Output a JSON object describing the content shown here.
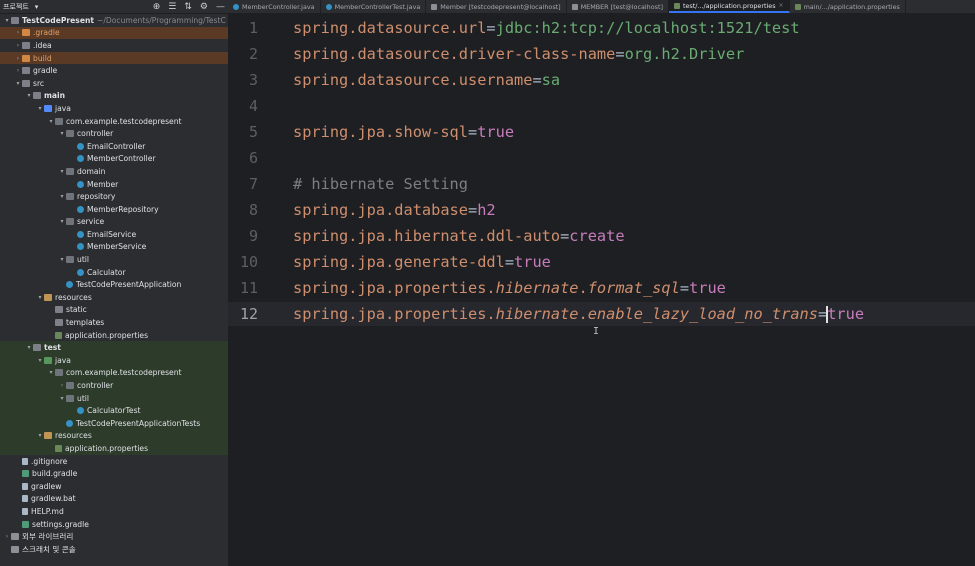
{
  "sidebar": {
    "title": "프로젝트",
    "title_arrow": "▾",
    "tools": [
      "⊕",
      "☰",
      "⇅",
      "⚙",
      "—"
    ],
    "rows": [
      {
        "indent": 0,
        "arrow": "▾",
        "icon": "folder",
        "label": "TestCodePresent",
        "extra": "~/Documents/Programming/TestC",
        "bold": true
      },
      {
        "indent": 1,
        "arrow": "›",
        "icon": "folder-orange",
        "label": ".gradle",
        "bg": "orange",
        "color": "orange"
      },
      {
        "indent": 1,
        "arrow": "›",
        "icon": "folder",
        "label": ".idea"
      },
      {
        "indent": 1,
        "arrow": "›",
        "icon": "folder-orange",
        "label": "build",
        "bg": "orange",
        "color": "orange"
      },
      {
        "indent": 1,
        "arrow": "›",
        "icon": "folder",
        "label": "gradle"
      },
      {
        "indent": 1,
        "arrow": "▾",
        "icon": "folder",
        "label": "src"
      },
      {
        "indent": 2,
        "arrow": "▾",
        "icon": "folder",
        "label": "main",
        "bold": true
      },
      {
        "indent": 3,
        "arrow": "▾",
        "icon": "folder-src",
        "label": "java"
      },
      {
        "indent": 4,
        "arrow": "▾",
        "icon": "pkg",
        "label": "com.example.testcodepresent"
      },
      {
        "indent": 5,
        "arrow": "▾",
        "icon": "pkg",
        "label": "controller"
      },
      {
        "indent": 6,
        "arrow": "",
        "icon": "cls",
        "label": "EmailController"
      },
      {
        "indent": 6,
        "arrow": "",
        "icon": "cls",
        "label": "MemberController"
      },
      {
        "indent": 5,
        "arrow": "▾",
        "icon": "pkg",
        "label": "domain"
      },
      {
        "indent": 6,
        "arrow": "",
        "icon": "cls",
        "label": "Member"
      },
      {
        "indent": 5,
        "arrow": "▾",
        "icon": "pkg",
        "label": "repository"
      },
      {
        "indent": 6,
        "arrow": "",
        "icon": "cls",
        "label": "MemberRepository"
      },
      {
        "indent": 5,
        "arrow": "▾",
        "icon": "pkg",
        "label": "service"
      },
      {
        "indent": 6,
        "arrow": "",
        "icon": "cls",
        "label": "EmailService"
      },
      {
        "indent": 6,
        "arrow": "",
        "icon": "cls",
        "label": "MemberService"
      },
      {
        "indent": 5,
        "arrow": "▾",
        "icon": "pkg",
        "label": "util"
      },
      {
        "indent": 6,
        "arrow": "",
        "icon": "cls",
        "label": "Calculator"
      },
      {
        "indent": 5,
        "arrow": "",
        "icon": "cls",
        "label": "TestCodePresentApplication"
      },
      {
        "indent": 3,
        "arrow": "▾",
        "icon": "folder-res",
        "label": "resources"
      },
      {
        "indent": 4,
        "arrow": "",
        "icon": "folder",
        "label": "static"
      },
      {
        "indent": 4,
        "arrow": "",
        "icon": "folder",
        "label": "templates"
      },
      {
        "indent": 4,
        "arrow": "",
        "icon": "prop",
        "label": "application.properties"
      },
      {
        "indent": 2,
        "arrow": "▾",
        "icon": "folder",
        "label": "test",
        "bold": true,
        "bg": "green"
      },
      {
        "indent": 3,
        "arrow": "▾",
        "icon": "folder-test",
        "label": "java",
        "bg": "green"
      },
      {
        "indent": 4,
        "arrow": "▾",
        "icon": "pkg",
        "label": "com.example.testcodepresent",
        "bg": "green"
      },
      {
        "indent": 5,
        "arrow": "›",
        "icon": "pkg",
        "label": "controller",
        "bg": "green"
      },
      {
        "indent": 5,
        "arrow": "▾",
        "icon": "pkg",
        "label": "util",
        "bg": "green"
      },
      {
        "indent": 6,
        "arrow": "",
        "icon": "cls",
        "label": "CalculatorTest",
        "bg": "green"
      },
      {
        "indent": 5,
        "arrow": "",
        "icon": "cls",
        "label": "TestCodePresentApplicationTests",
        "bg": "green"
      },
      {
        "indent": 3,
        "arrow": "▾",
        "icon": "folder-res",
        "label": "resources",
        "bg": "green"
      },
      {
        "indent": 4,
        "arrow": "",
        "icon": "prop",
        "label": "application.properties",
        "bg": "green"
      },
      {
        "indent": 1,
        "arrow": "",
        "icon": "file",
        "label": ".gitignore"
      },
      {
        "indent": 1,
        "arrow": "",
        "icon": "gradle",
        "label": "build.gradle"
      },
      {
        "indent": 1,
        "arrow": "",
        "icon": "file",
        "label": "gradlew"
      },
      {
        "indent": 1,
        "arrow": "",
        "icon": "file",
        "label": "gradlew.bat"
      },
      {
        "indent": 1,
        "arrow": "",
        "icon": "file",
        "label": "HELP.md"
      },
      {
        "indent": 1,
        "arrow": "",
        "icon": "gradle",
        "label": "settings.gradle"
      },
      {
        "indent": 0,
        "arrow": "›",
        "icon": "lib",
        "label": "외부 라이브러리"
      },
      {
        "indent": 0,
        "arrow": "",
        "icon": "lib",
        "label": "스크래치 및 콘솔"
      }
    ]
  },
  "tabs": [
    {
      "label": "MemberController.java",
      "icon": "class"
    },
    {
      "label": "MemberControllerTest.java",
      "icon": "class"
    },
    {
      "label": "Member [testcodepresent@localhost]",
      "icon": "db"
    },
    {
      "label": "MEMBER [test@localhost]",
      "icon": "db"
    },
    {
      "label": "test/.../application.properties",
      "icon": "prop",
      "active": true
    },
    {
      "label": "main/.../application.properties",
      "icon": "prop"
    }
  ],
  "tab_close": "×",
  "editor": {
    "current_line": 12,
    "lines": [
      {
        "n": "1",
        "key": "spring.datasource.url",
        "val": "jdbc:h2:tcp://localhost:1521/test",
        "type": "plain"
      },
      {
        "n": "2",
        "key": "spring.datasource.driver-class-name",
        "val": "org.h2.Driver",
        "type": "plain"
      },
      {
        "n": "3",
        "key": "spring.datasource.username",
        "val": "sa",
        "type": "plain"
      },
      {
        "n": "4",
        "type": "empty"
      },
      {
        "n": "5",
        "key": "spring.jpa.show-sql",
        "val": "true",
        "type": "kw"
      },
      {
        "n": "6",
        "type": "empty"
      },
      {
        "n": "7",
        "text": "# hibernate Setting",
        "type": "comment"
      },
      {
        "n": "8",
        "key": "spring.jpa.database",
        "val": "h2",
        "type": "kw"
      },
      {
        "n": "9",
        "key": "spring.jpa.hibernate.ddl-auto",
        "val": "create",
        "type": "kw"
      },
      {
        "n": "10",
        "key": "spring.jpa.generate-ddl",
        "val": "true",
        "type": "kw"
      },
      {
        "n": "11",
        "key_pre": "spring.jpa.properties.",
        "key_it": "hibernate",
        "key_mid": ".",
        "key_it2": "format_sql",
        "val": "true",
        "type": "italic"
      },
      {
        "n": "12",
        "key_pre": "spring.jpa.properties.",
        "key_it": "hibernate",
        "key_mid": ".",
        "key_it2": "enable_lazy_load_no_trans",
        "val": "true",
        "type": "italic",
        "caret": true
      }
    ]
  },
  "colors": {
    "key": "#cf8e6d",
    "value": "#6aab73",
    "keyword": "#c77dbb",
    "comment": "#7a7e85",
    "equals": "#bcbec4"
  }
}
